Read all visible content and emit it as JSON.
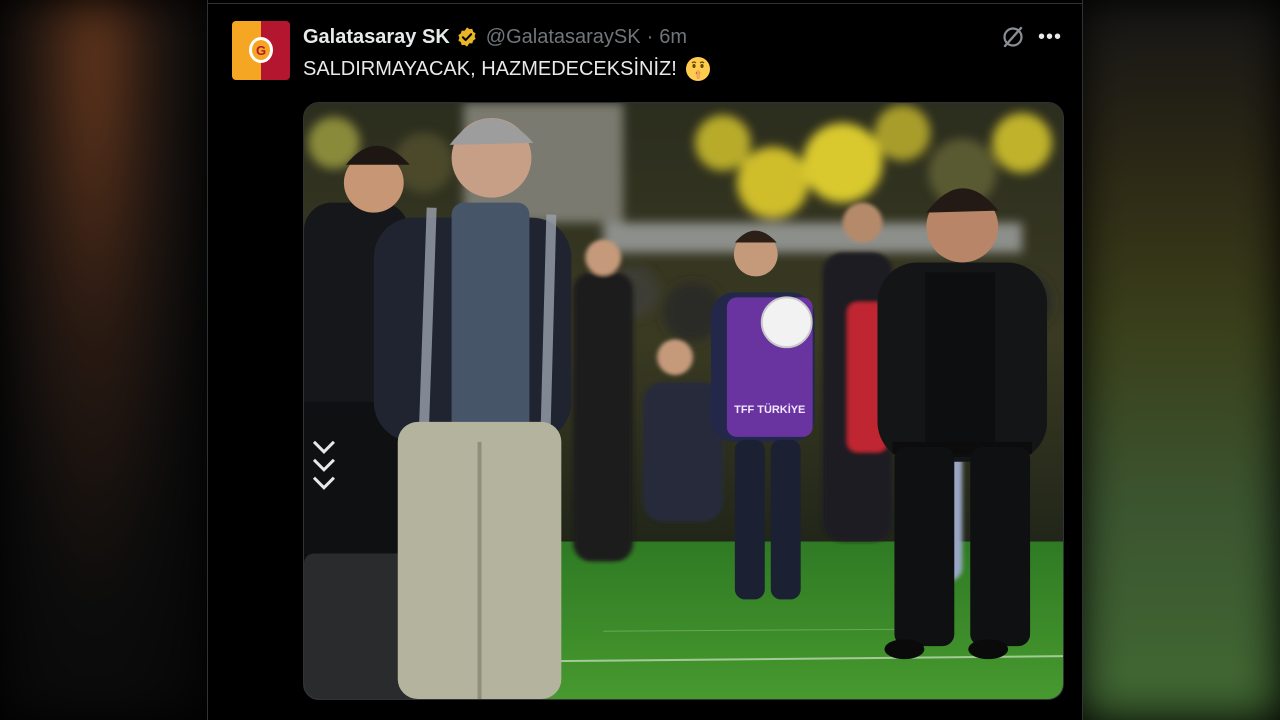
{
  "tweet": {
    "display_name": "Galatasaray SK",
    "handle": "@GalatasaraySK",
    "separator": "·",
    "time": "6m",
    "text": "SALDIRMAYACAK, HAZMEDECEKSİNİZ!",
    "emoji": "shushing-face-emoji",
    "verified_badge_color": "#e8b625",
    "avatar_colors": [
      "#f5a623",
      "#b4162f"
    ],
    "avatar_initial": "G"
  },
  "media": {
    "type": "photo",
    "ball_text": "TFF TÜRKİYE",
    "bib_text": "TFF TÜRKİYE"
  },
  "icons": {
    "grok": "grok-icon",
    "more": "more-icon",
    "more_glyph": "•••",
    "verified": "verified-badge-icon"
  },
  "colors": {
    "background": "#000000",
    "text_primary": "#e7e9ea",
    "text_secondary": "#71767b",
    "border": "#2f3336",
    "pitch_green": "#3f8f2e"
  }
}
